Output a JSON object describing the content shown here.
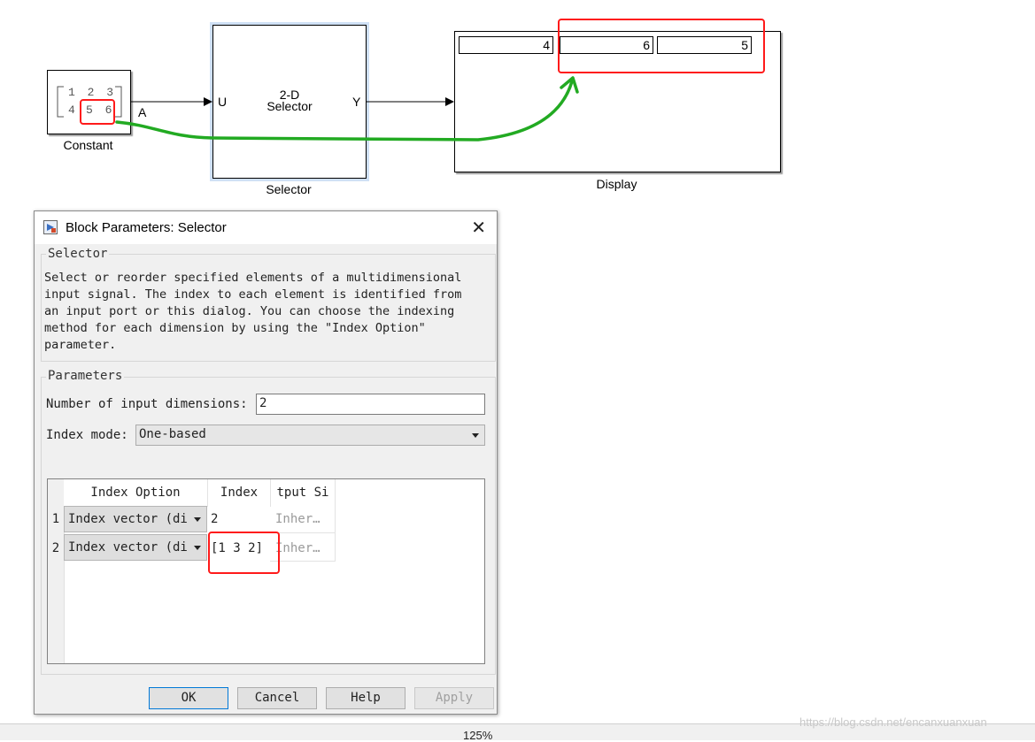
{
  "model": {
    "constant": {
      "label": "Constant",
      "row1": "1 2 3",
      "row2_first": "4",
      "row2_highlight": "5 6",
      "port_out": "A"
    },
    "selector": {
      "label": "Selector",
      "text_line1": "2-D",
      "text_line2": "Selector",
      "port_in": "U",
      "port_out": "Y"
    },
    "display": {
      "label": "Display",
      "values": [
        "4",
        "6",
        "5"
      ]
    },
    "annotation_colors": {
      "highlight": "#ff1a1a",
      "arrow": "#22aa22"
    }
  },
  "dialog": {
    "title": "Block Parameters: Selector",
    "section1": "Selector",
    "description": "Select or reorder specified elements of a multidimensional\ninput signal. The index to each element is identified from\nan input port or this dialog. You can choose the indexing\nmethod for each dimension by using the \"Index Option\"\nparameter.",
    "section2": "Parameters",
    "num_dims_label": "Number of input dimensions:",
    "num_dims_value": "2",
    "index_mode_label": "Index mode:",
    "index_mode_value": "One-based",
    "table": {
      "headers": [
        "Index Option",
        "Index",
        "tput Si"
      ],
      "rows": [
        {
          "num": "1",
          "option": "Index vector (di",
          "index": "2",
          "output": "Inher…"
        },
        {
          "num": "2",
          "option": "Index vector (di",
          "index": "[1 3 2]",
          "output": "Inher…"
        }
      ]
    },
    "buttons": {
      "ok": "OK",
      "cancel": "Cancel",
      "help": "Help",
      "apply": "Apply"
    }
  },
  "status": {
    "zoom": "125%"
  },
  "watermark": "https://blog.csdn.net/encanxuanxuan"
}
